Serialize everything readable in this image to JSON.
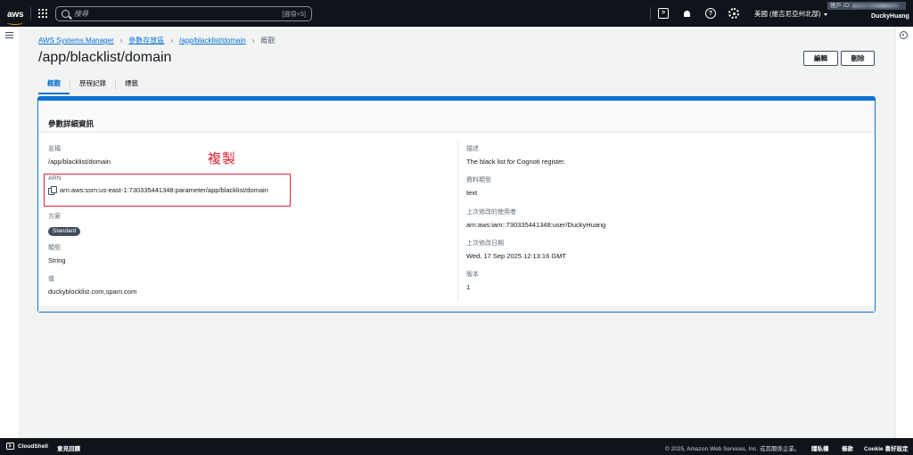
{
  "topnav": {
    "logo_text": "aws",
    "search_placeholder": "搜尋",
    "search_shortcut": "[選項+S]",
    "region_label": "美國 (維吉尼亞州北部)",
    "account_label": "帳戶 ID:",
    "user_name": "DuckyHuang"
  },
  "breadcrumb": {
    "items": [
      "AWS Systems Manager",
      "參數存放區",
      "/app/blacklist/domain"
    ],
    "current": "概觀"
  },
  "page": {
    "title": "/app/blacklist/domain",
    "edit_label": "編輯",
    "delete_label": "刪除"
  },
  "tabs": [
    "概觀",
    "歷程記錄",
    "標籤"
  ],
  "panel": {
    "title": "參數詳細資訊",
    "left": {
      "name_label": "名稱",
      "name_value": "/app/blacklist/domain",
      "arn_label": "ARN",
      "arn_value": "arn:aws:ssm:us-east-1:730335441348:parameter/app/blacklist/domain",
      "tier_label": "方案",
      "tier_value": "Standard",
      "type_label": "類型",
      "type_value": "String",
      "value_label": "值",
      "value_value": "duckyblocklist.com,spam.com"
    },
    "right": {
      "description_label": "描述",
      "description_value": "The black list for Cognoti register.",
      "datatype_label": "資料類型",
      "datatype_value": "text",
      "modified_by_label": "上次修改的使用者",
      "modified_by_value": "arn:aws:iam::730335441348:user/DuckyHuang",
      "modified_date_label": "上次修改日期",
      "modified_date_value": "Wed, 17 Sep 2025 12:13:16 GMT",
      "version_label": "版本",
      "version_value": "1"
    }
  },
  "annotation": {
    "text": "複製",
    "color": "#e02433"
  },
  "bottombar": {
    "cloudshell_label": "CloudShell",
    "feedback_label": "意見回饋",
    "copyright": "© 2025, Amazon Web Services, Inc. 或其關係企業。",
    "privacy_label": "隱私權",
    "terms_label": "條款",
    "cookie_label": "Cookie 喜好設定"
  },
  "colors": {
    "nav_bg": "#0f141a",
    "accent": "#0972d3",
    "logo_smile": "#ff9900"
  }
}
